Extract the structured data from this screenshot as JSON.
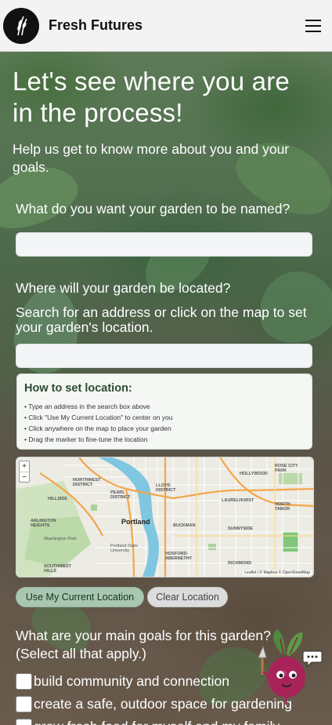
{
  "header": {
    "brand": "Fresh Futures",
    "logo_icon": "wheat-icon",
    "menu_icon": "hamburger-menu-icon"
  },
  "hero": {
    "title": "Let's see where you are in the process!",
    "subtitle": "Help us get to know more about you and your goals."
  },
  "garden_name": {
    "label": "What do you want your garden to be named?",
    "value": "",
    "placeholder": ""
  },
  "location": {
    "label": "Where will your garden be located?",
    "search_help": "Search for an address or click on the map to set your garden's location.",
    "search_value": "",
    "search_placeholder": ""
  },
  "howto": {
    "title": "How to set location:",
    "steps": [
      "Type an address in the search box above",
      "Click \"Use My Current Location\" to center on you",
      "Click anywhere on the map to place your garden",
      "Drag the marker to fine-tune the location"
    ]
  },
  "map": {
    "city": "Portland",
    "zoom_in": "+",
    "zoom_out": "−",
    "attribution": "Leaflet | © Mapbox © OpenStreetMap",
    "labels": {
      "northwest": "NORTHWEST DISTRICT",
      "pearl": "PEARL DISTRICT",
      "hillside": "HILLSIDE",
      "lloyd": "LLOYD DISTRICT",
      "hollywood": "HOLLYWOOD",
      "rose_city": "ROSE CITY PARK",
      "laurelhurst": "LAURELHURST",
      "north_tabor": "NORTH TABOR",
      "arlington": "ARLINGTON HEIGHTS",
      "washington_park": "Washington Park",
      "buckman": "BUCKMAN",
      "sunnyside": "SUNNYSIDE",
      "hosford": "HOSFORD-ABERNETHY",
      "richmond": "RICHMOND",
      "southwest_hills": "SOUTHWEST HILLS",
      "portland_state": "Portland State University"
    }
  },
  "buttons": {
    "current_location": "Use My Current Location",
    "clear_location": "Clear Location"
  },
  "goals": {
    "label": "What are your main goals for this garden? (Select all that apply.)",
    "options": [
      "build community and connection",
      "create a safe, outdoor space for gardening",
      "grow fresh food for myself and my family"
    ]
  },
  "mascot": {
    "icon": "beet-mascot-icon",
    "chat_icon": "chat-bubble-icon"
  },
  "colors": {
    "primary_button": "#a9c7b0",
    "secondary_button": "#dcdcdc",
    "howto_title": "#2c4a30",
    "river": "#7fc6e0",
    "freeway": "#f4a64a"
  }
}
